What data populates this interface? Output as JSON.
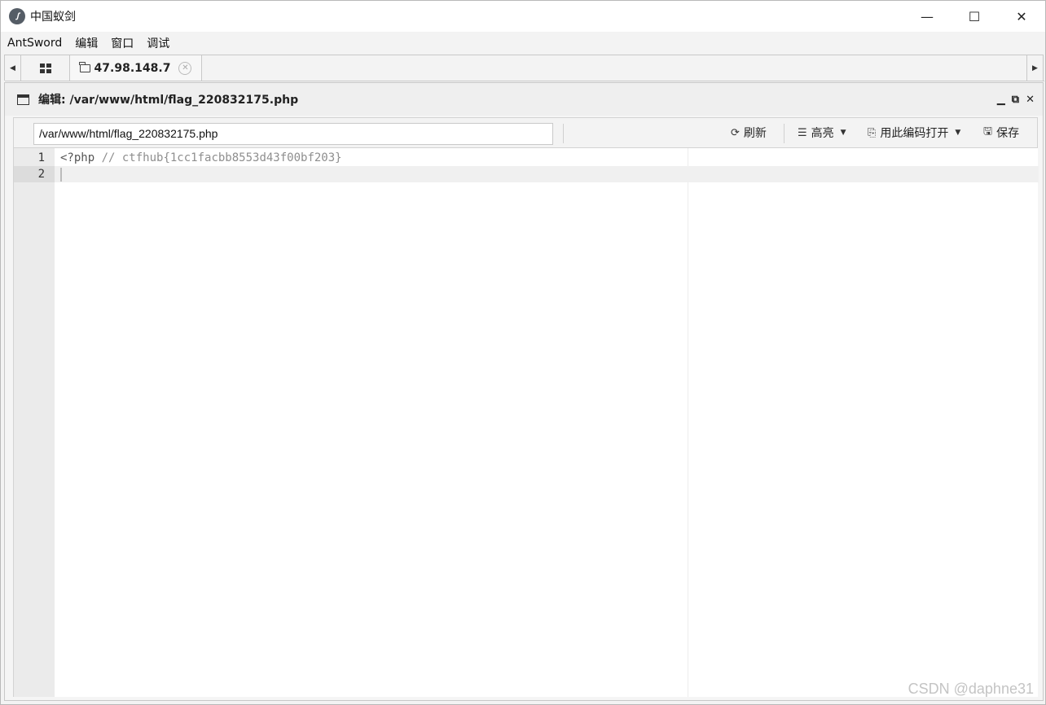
{
  "window": {
    "title": "中国蚁剑",
    "icon": "antsword-logo-icon",
    "controls": {
      "minimize": "—",
      "maximize": "☐",
      "close": "✕"
    }
  },
  "menu": {
    "items": [
      {
        "label": "AntSword"
      },
      {
        "label": "编辑"
      },
      {
        "label": "窗口"
      },
      {
        "label": "调试"
      }
    ]
  },
  "tabs": {
    "home_icon": "grid-icon",
    "active": {
      "label": "47.98.148.7",
      "icon": "folder-icon",
      "close_icon": "close-circle-icon"
    }
  },
  "editor_panel": {
    "title": "编辑: /var/www/html/flag_220832175.php",
    "controls": {
      "minimize": "▁",
      "restore": "⧉",
      "close": "✕"
    },
    "toolbar": {
      "path_value": "/var/www/html/flag_220832175.php",
      "refresh_label": "刷新",
      "highlight_label": "高亮",
      "encoding_label": "用此编码打开",
      "save_label": "保存"
    },
    "code": {
      "lines": [
        {
          "number": "1",
          "keyword": "<?php",
          "comment": " // ctfhub{1cc1facbb8553d43f00bf203}"
        },
        {
          "number": "2",
          "keyword": "",
          "comment": ""
        }
      ]
    }
  },
  "watermark": "CSDN @daphne31",
  "colors": {
    "accent_gutter": "#ebebeb",
    "comment": "#8e8e8e"
  }
}
